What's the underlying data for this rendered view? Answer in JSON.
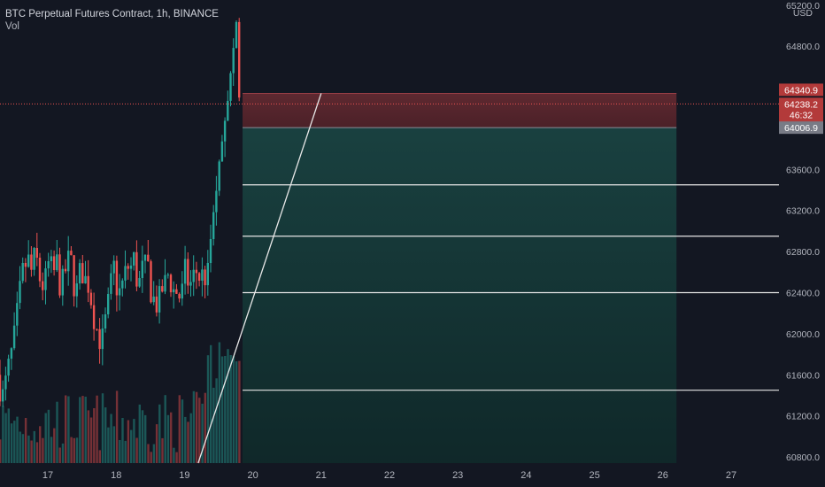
{
  "header": {
    "symbol_line": "BTC Perpetual Futures Contract, 1h, BINANCE",
    "volume_label": "Vol"
  },
  "axis": {
    "currency": "USD"
  },
  "badges": {
    "target": "64340.9",
    "last_price": "64238.2",
    "countdown": "46:32",
    "stop": "64006.9"
  },
  "colors": {
    "background": "#131722",
    "up": "#26a69a",
    "down": "#ef5350",
    "loss_zone": "#5a2a30",
    "profit_zone": "#123a37",
    "price_badge": "#b33a3a",
    "gray_badge": "#787b86"
  },
  "chart_data": {
    "type": "candlestick",
    "title": "BTC Perpetual Futures Contract, 1h, BINANCE",
    "x_tick_labels": [
      "17",
      "18",
      "19",
      "20",
      "21",
      "22",
      "23",
      "24",
      "25",
      "26",
      "27"
    ],
    "y_tick_labels": [
      "65200.0",
      "64800.0",
      "63600.0",
      "63200.0",
      "62800.0",
      "62400.0",
      "62000.0",
      "61600.0",
      "61200.0",
      "60800.0"
    ],
    "y_ticks": [
      65200,
      64800,
      63600,
      63200,
      62800,
      62400,
      62000,
      61600,
      61200,
      60800
    ],
    "ylim": [
      60740,
      65250
    ],
    "x_domain": [
      16.3,
      27.7
    ],
    "last_price": 64238.2,
    "position": {
      "side": "short",
      "start_day": 19.85,
      "end_day": 26.2,
      "entry": 64006.9,
      "stop": 64340.9,
      "target": 60740,
      "loss_zone": [
        64006.9,
        64340.9
      ],
      "profit_zone": [
        60740,
        64006.9
      ]
    },
    "horizontal_levels": [
      63450,
      62950,
      62400,
      61450
    ],
    "trend_line": {
      "from": [
        19.2,
        60740
      ],
      "to": [
        21.0,
        64340.9
      ]
    },
    "candles_approx": {
      "from_day": 16.3,
      "to_day": 19.85,
      "typical_range": [
        61000,
        62800
      ],
      "final_close": 64300
    }
  }
}
